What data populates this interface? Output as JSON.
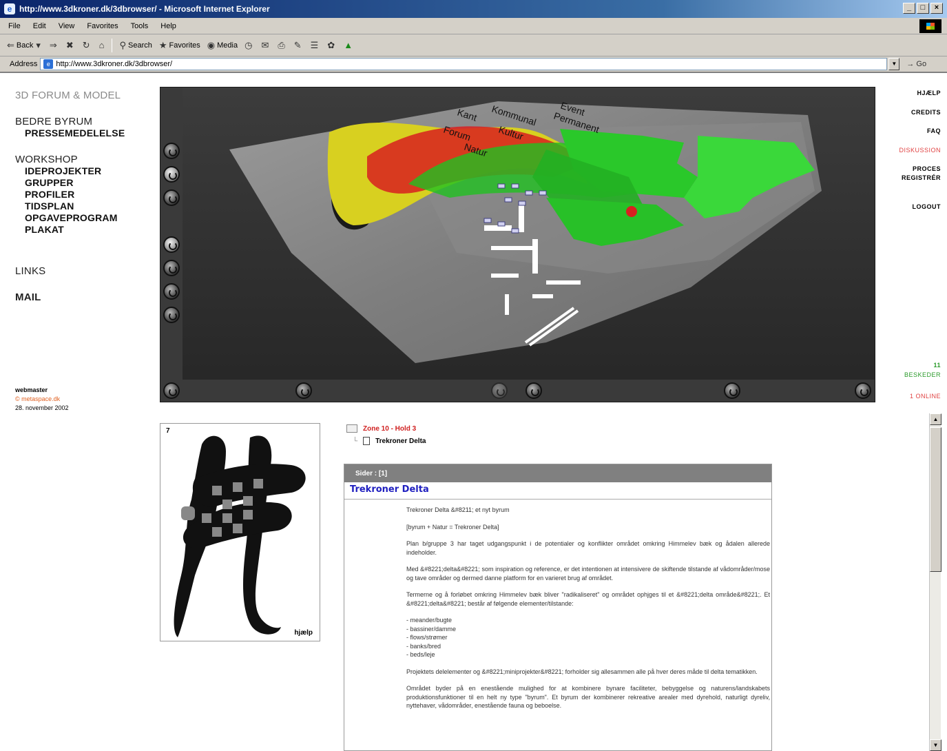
{
  "window": {
    "title": "http://www.3dkroner.dk/3dbrowser/ - Microsoft Internet Explorer",
    "controls": [
      "_",
      "□",
      "×"
    ]
  },
  "menu": [
    "File",
    "Edit",
    "View",
    "Favorites",
    "Tools",
    "Help"
  ],
  "toolbar": {
    "back": "Back",
    "search": "Search",
    "favorites": "Favorites",
    "media": "Media"
  },
  "address": {
    "label": "Address",
    "url": "http://www.3dkroner.dk/3dbrowser/",
    "go": "Go"
  },
  "nav": {
    "site_title": "3D FORUM & MODEL",
    "bedre": "BEDRE BYRUM",
    "presse": "PRESSEMEDELELSE",
    "workshop": "WORKSHOP",
    "workshop_items": [
      "IDEPROJEKTER",
      "GRUPPER",
      "PROFILER",
      "TIDSPLAN",
      "OPGAVEPROGRAM",
      "PLAKAT"
    ],
    "links": "LINKS",
    "mail": "MAIL"
  },
  "webmaster": {
    "title": "webmaster",
    "email": "© metaspace.dk",
    "date": "28. november 2002"
  },
  "viewer_labels": [
    "Kant",
    "Kommunal",
    "Event",
    "Permanent",
    "Forum",
    "Kultur",
    "Natur"
  ],
  "right_nav": {
    "hjaelp": "HJÆLP",
    "credits": "CREDITS",
    "faq": "FAQ",
    "diskussion": "DISKUSSION",
    "proces": "PROCES",
    "registrer": "REGISTRÉR",
    "logout": "LOGOUT",
    "count": "11",
    "beskeder": "BESKEDER",
    "online": "1 ONLINE"
  },
  "minimap": {
    "number": "7",
    "help": "hjælp"
  },
  "tree": {
    "folder": "Zone 10 - Hold 3",
    "doc": "Trekroner Delta"
  },
  "article": {
    "header": "Sider :   [1]",
    "title": "Trekroner Delta",
    "p1": "Trekroner Delta &#8211; et nyt byrum",
    "p2": "[byrum + Natur = Trekroner Delta]",
    "p3": "Plan b/gruppe 3 har taget udgangspunkt i de potentialer og konflikter området omkring Himmelev bæk og ådalen allerede indeholder.",
    "p4": "Med &#8221;delta&#8221; som inspiration og reference, er det intentionen at intensivere de skiftende tilstande af vådområder/mose og tave områder og dermed danne platform for en varieret brug af området.",
    "p5": "Termerne og å forløbet omkring Himmelev bæk bliver \"radikaliseret\" og området ophjges til et &#8221;delta område&#8221;. Et &#8221;delta&#8221; består af følgende elementer/tilstande:",
    "list": [
      "- meander/bugte",
      "- bassiner/damme",
      "- flows/strømer",
      "- banks/bred",
      "- beds/leje"
    ],
    "p6": "Projektets delelementer og &#8221;miniprojekter&#8221; forholder sig allesammen alle på hver deres måde til delta tematikken.",
    "p7": "Området byder på en enestående mulighed for at kombinere bynare faciliteter, bebyggelse og naturens/landskabets produktionsfunktioner til en helt ny type \"byrum\". Et byrum der kombinerer rekreative arealer med dyrehold, naturligt dyreliv, nyttehaver, vådområder, enestående fauna og beboelse."
  }
}
